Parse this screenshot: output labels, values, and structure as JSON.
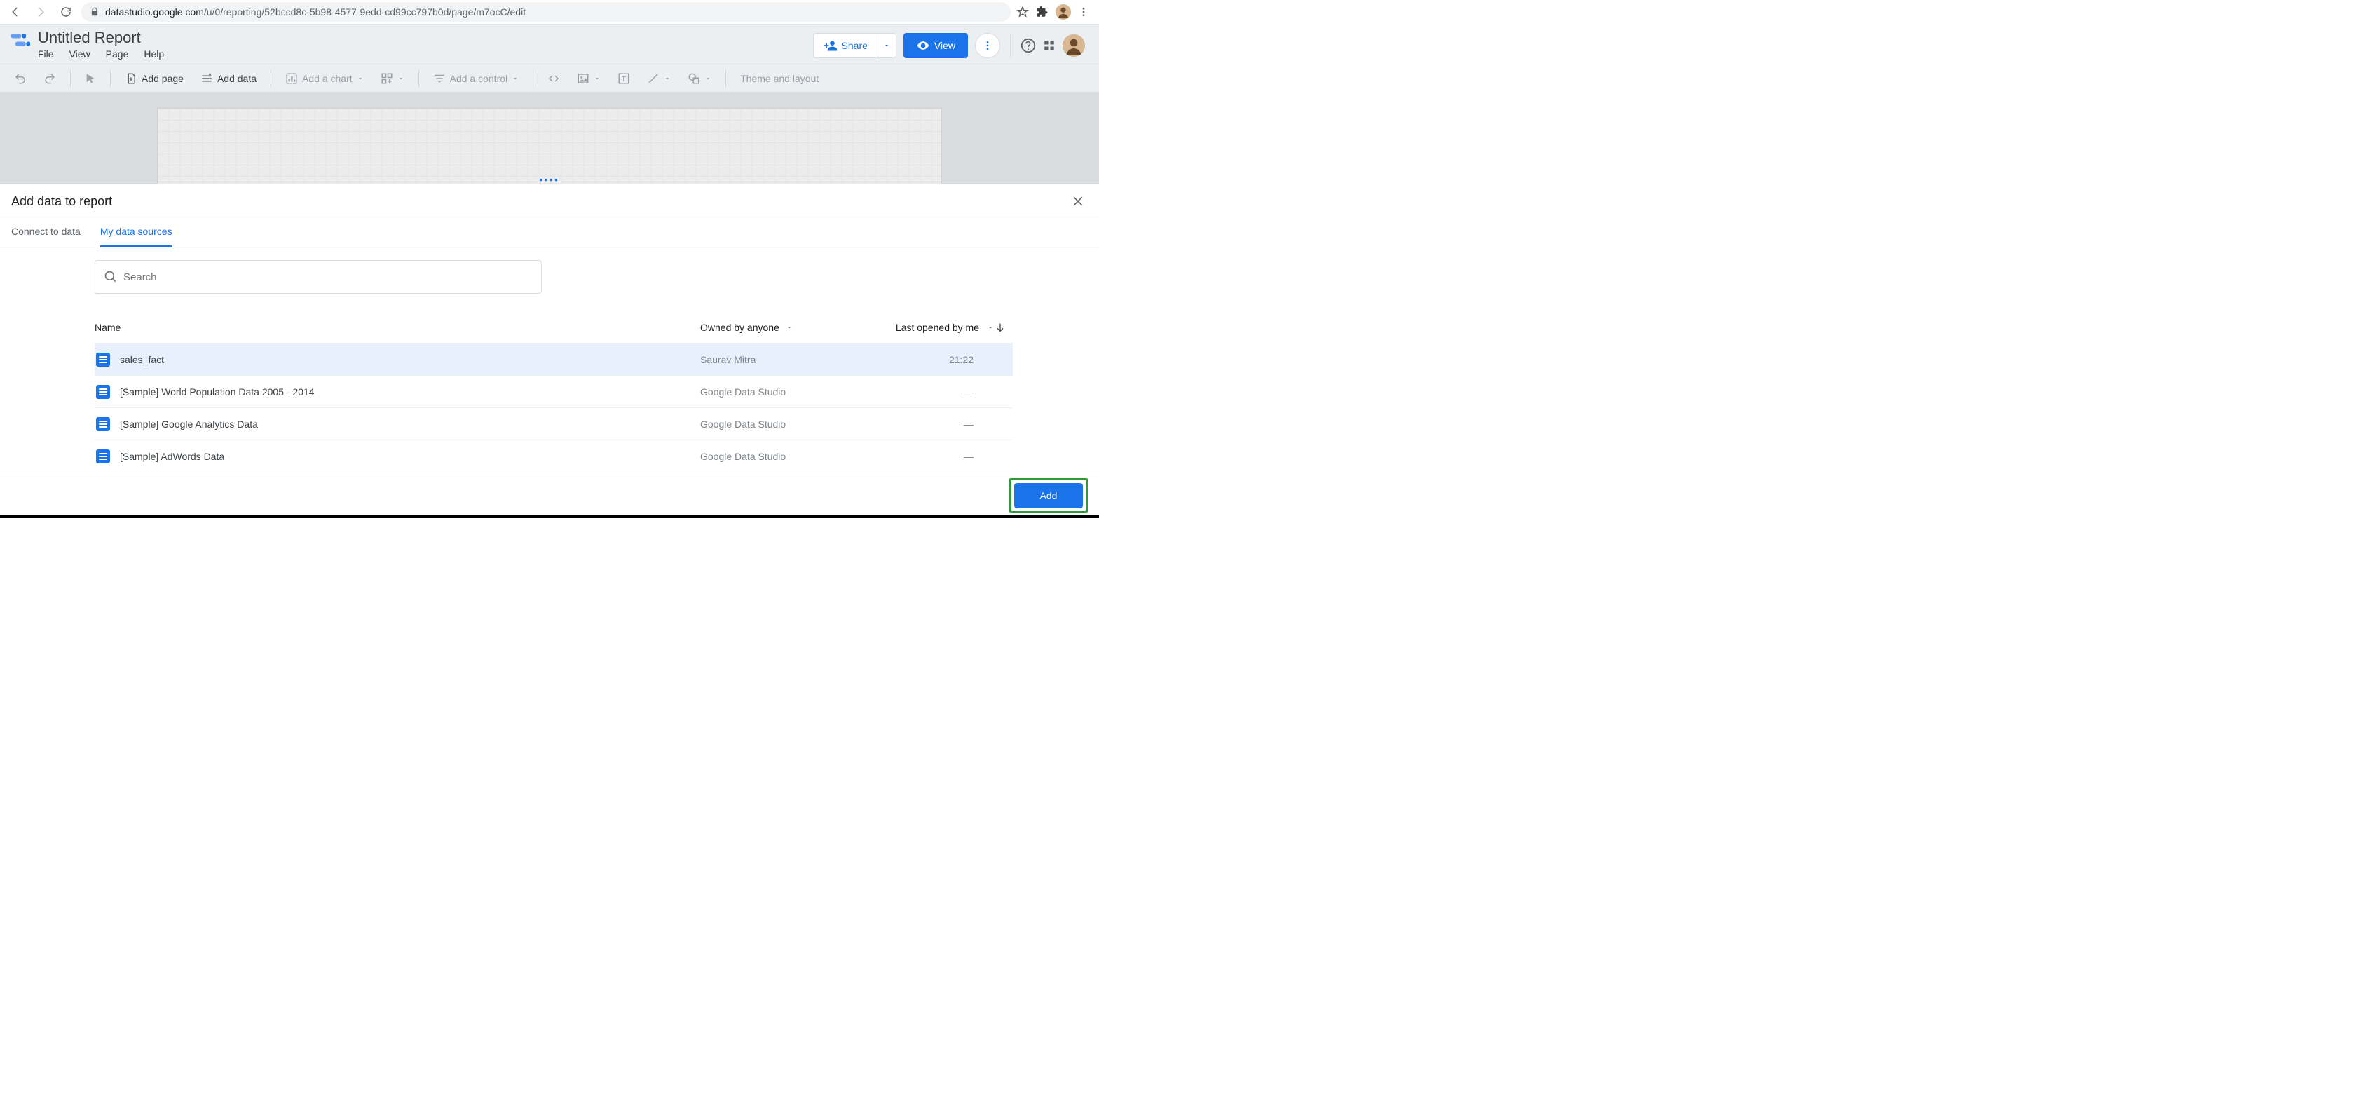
{
  "browser": {
    "url_domain": "datastudio.google.com",
    "url_path": "/u/0/reporting/52bccd8c-5b98-4577-9edd-cd99cc797b0d/page/m7ocC/edit"
  },
  "header": {
    "title": "Untitled Report",
    "menu": {
      "file": "File",
      "view": "View",
      "page": "Page",
      "help": "Help"
    },
    "share": "Share",
    "view_btn": "View"
  },
  "toolbar": {
    "add_page": "Add page",
    "add_data": "Add data",
    "add_chart": "Add a chart",
    "add_control": "Add a control",
    "theme": "Theme and layout"
  },
  "panel": {
    "title": "Add data to report",
    "tabs": {
      "connect": "Connect to data",
      "mine": "My data sources"
    },
    "search_placeholder": "Search",
    "columns": {
      "name": "Name",
      "owner": "Owned by anyone",
      "opened": "Last opened by me"
    },
    "rows": [
      {
        "name": "sales_fact",
        "owner": "Saurav Mitra",
        "opened": "21:22",
        "selected": true
      },
      {
        "name": "[Sample] World Population Data 2005 - 2014",
        "owner": "Google Data Studio",
        "opened": "—",
        "selected": false
      },
      {
        "name": "[Sample] Google Analytics Data",
        "owner": "Google Data Studio",
        "opened": "—",
        "selected": false
      },
      {
        "name": "[Sample] AdWords Data",
        "owner": "Google Data Studio",
        "opened": "—",
        "selected": false
      }
    ],
    "add_btn": "Add"
  }
}
